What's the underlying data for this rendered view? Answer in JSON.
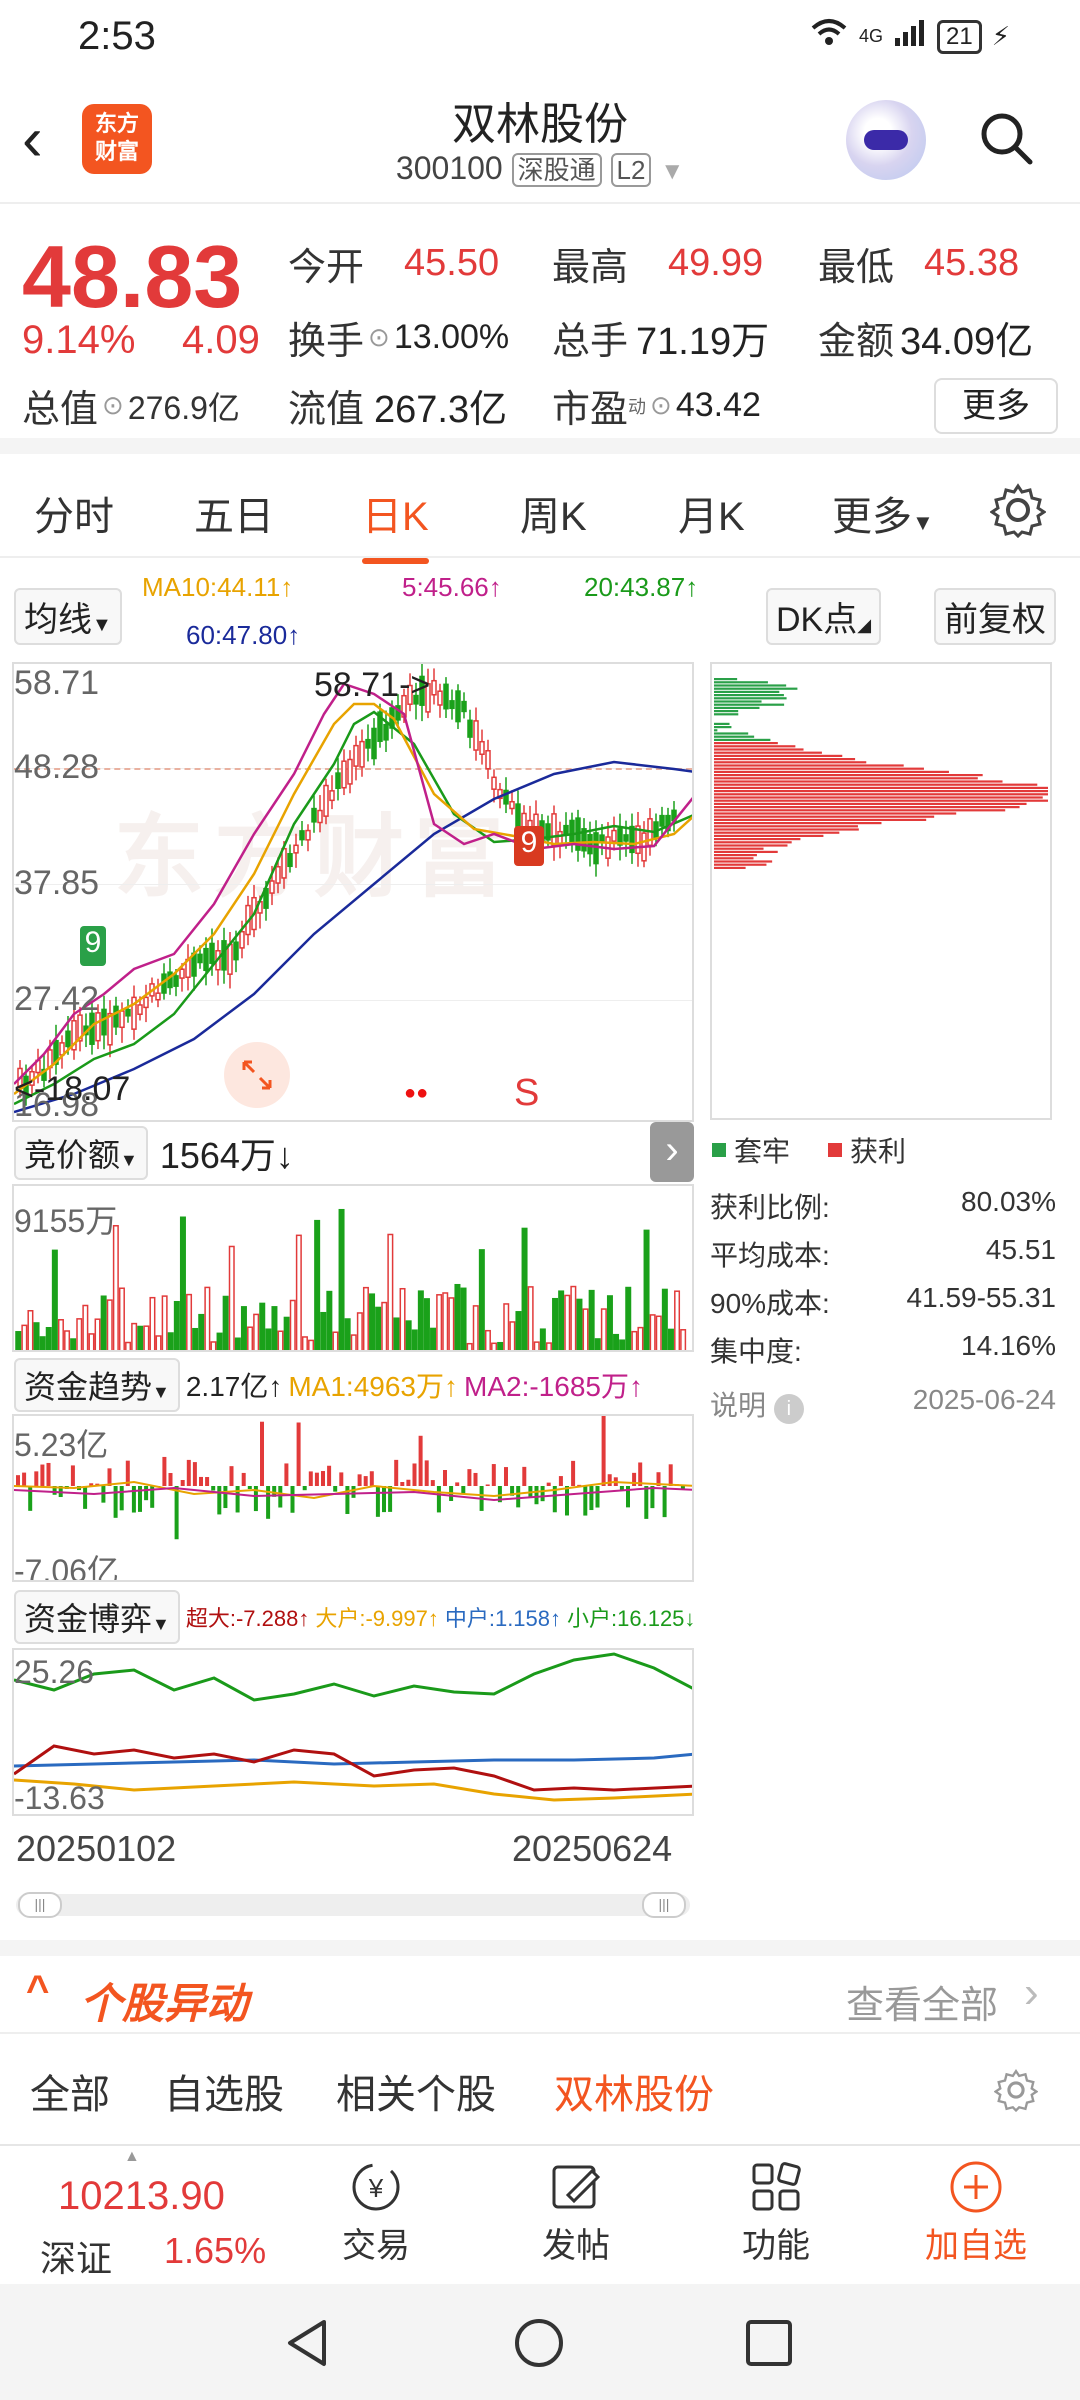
{
  "status": {
    "time": "2:53",
    "signal": "4G",
    "battery": "21"
  },
  "nav": {
    "title": "双林股份",
    "code": "300100",
    "tag1": "深股通",
    "tag2": "L2",
    "logo_line1": "东方",
    "logo_line2": "财富"
  },
  "quote": {
    "price": "48.83",
    "pct": "9.14%",
    "chg": "4.09",
    "open_label": "今开",
    "open": "45.50",
    "high_label": "最高",
    "high": "49.99",
    "low_label": "最低",
    "low": "45.38",
    "turnover_label": "换手",
    "turnover": "13.00%",
    "volume_label": "总手",
    "volume": "71.19万",
    "amount_label": "金额",
    "amount": "34.09亿",
    "mcap_label": "总值",
    "mcap": "276.9亿",
    "float_label": "流值",
    "float": "267.3亿",
    "pe_label": "市盈",
    "pe_sup": "动",
    "pe": "43.42",
    "more": "更多"
  },
  "tabs": [
    "分时",
    "五日",
    "日K",
    "周K",
    "月K",
    "更多"
  ],
  "ma": {
    "button": "均线",
    "ma10": "MA10:44.11↑",
    "ma5": "5:45.66↑",
    "ma20": "20:43.87↑",
    "ma60": "60:47.80↑",
    "dk": "DK点",
    "fq": "前复权"
  },
  "kline": {
    "y_top": "58.71",
    "y_2": "48.28",
    "y_3": "37.85",
    "y_4": "27.42",
    "y_bot": "16.98",
    "high_note": "58.71->",
    "low_note": "<-18.07",
    "s_mark": "S",
    "watermark": "东方财富",
    "marker_9a": "9",
    "marker_9b": "9"
  },
  "auction": {
    "button": "竞价额",
    "value": "1564万↓",
    "y_top": "9155万"
  },
  "flow": {
    "button": "资金趋势",
    "value": "2.17亿↑",
    "ma1": "MA1:4963万↑",
    "ma2": "MA2:-1685万↑",
    "y_top": "5.23亿",
    "y_bot": "-7.06亿"
  },
  "game": {
    "button": "资金博弈",
    "super": "超大:-7.288↑",
    "big": "大户:-9.997↑",
    "mid": "中户:1.158↑",
    "small": "小户:16.125↓",
    "y_top": "25.26",
    "y_bot": "-13.63"
  },
  "dates": {
    "start": "20250102",
    "end": "20250624"
  },
  "chips": {
    "legend_trap": "套牢",
    "legend_profit": "获利",
    "rows": [
      {
        "label": "获利比例:",
        "value": "80.03%"
      },
      {
        "label": "平均成本:",
        "value": "45.51"
      },
      {
        "label": "90%成本:",
        "value": "41.59-55.31"
      },
      {
        "label": "集中度:",
        "value": "14.16%"
      }
    ],
    "note": "说明",
    "date": "2025-06-24"
  },
  "alert": {
    "title": "个股异动",
    "view_all": "查看全部"
  },
  "filters": [
    "全部",
    "自选股",
    "相关个股",
    "双林股份"
  ],
  "bottombar": {
    "index_value": "10213.90",
    "index_name": "深证",
    "index_pct": "1.65%",
    "trade": "交易",
    "post": "发帖",
    "func": "功能",
    "add": "加自选"
  },
  "colors": {
    "up": "#e23a3a",
    "down": "#1aa11a",
    "accent": "#f35520",
    "ma5": "#c0208a",
    "ma10": "#e8a300",
    "ma20": "#1a9a1a",
    "ma60": "#1a2a9a"
  }
}
